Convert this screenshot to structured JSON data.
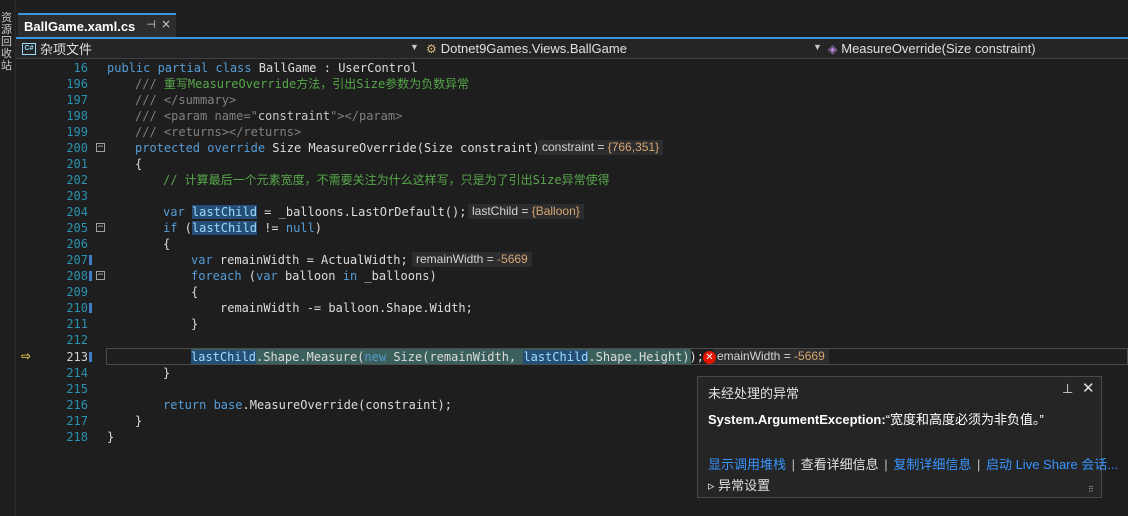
{
  "side_panel": {
    "label": "资源回收站"
  },
  "tab": {
    "title": "BallGame.xaml.cs",
    "pin": "⊣",
    "close": "×"
  },
  "nav": {
    "project": "杂项文件",
    "class": "Dotnet9Games.Views.BallGame",
    "member": "MeasureOverride(Size constraint)"
  },
  "lines": [
    {
      "no": "16",
      "text": "public partial class BallGame : UserControl"
    },
    {
      "no": "196",
      "text": "/// 重写MeasureOverride方法，引出Size参数为负数异常"
    },
    {
      "no": "197",
      "text": "/// </summary>"
    },
    {
      "no": "198",
      "text": "/// <param name=\"constraint\"></param>"
    },
    {
      "no": "199",
      "text": "/// <returns></returns>"
    },
    {
      "no": "200",
      "text": "protected override Size MeasureOverride(Size constraint)"
    },
    {
      "no": "201",
      "text": "{"
    },
    {
      "no": "202",
      "text": "// 计算最后一个元素宽度，不需要关注为什么这样写，只是为了引出Size异常使得"
    },
    {
      "no": "203",
      "text": ""
    },
    {
      "no": "204",
      "text": "var lastChild = _balloons.LastOrDefault();"
    },
    {
      "no": "205",
      "text": "if (lastChild != null)"
    },
    {
      "no": "206",
      "text": "{"
    },
    {
      "no": "207",
      "text": "var remainWidth = ActualWidth;"
    },
    {
      "no": "208",
      "text": "foreach (var balloon in _balloons)"
    },
    {
      "no": "209",
      "text": "{"
    },
    {
      "no": "210",
      "text": "remainWidth -= balloon.Shape.Width;"
    },
    {
      "no": "211",
      "text": "}"
    },
    {
      "no": "212",
      "text": ""
    },
    {
      "no": "213",
      "text": "lastChild.Shape.Measure(new Size(remainWidth, lastChild.Shape.Height));"
    },
    {
      "no": "214",
      "text": "}"
    },
    {
      "no": "215",
      "text": ""
    },
    {
      "no": "216",
      "text": "return base.MeasureOverride(constraint);"
    },
    {
      "no": "217",
      "text": "}"
    },
    {
      "no": "218",
      "text": "}"
    }
  ],
  "hints": {
    "constraint": {
      "name": "constraint = ",
      "value": "{766,351}"
    },
    "lastChild": {
      "name": "lastChild = ",
      "value": "{Balloon}"
    },
    "remainWidth": {
      "name": "remainWidth = ",
      "value": "-5669"
    },
    "remainWidth_213": {
      "name": "emainWidth = ",
      "value": "-5669"
    }
  },
  "exception": {
    "title": "未经处理的异常",
    "type": "System.ArgumentException:",
    "message": "“宽度和高度必须为非负值。”",
    "links": [
      "显示调用堆栈",
      "查看详细信息",
      "复制详细信息",
      "启动 Live Share 会话..."
    ],
    "separator": "|",
    "settings": "异常设置",
    "pin": "⊥",
    "close": "✕",
    "error_mark": "✕"
  },
  "colors": {
    "background": "#1e1e1e",
    "keyword": "#569cd6",
    "comment": "#57a64a",
    "line_number": "#2b91af",
    "link": "#3794ff",
    "accent": "#3a96dd",
    "error": "#e51400"
  }
}
